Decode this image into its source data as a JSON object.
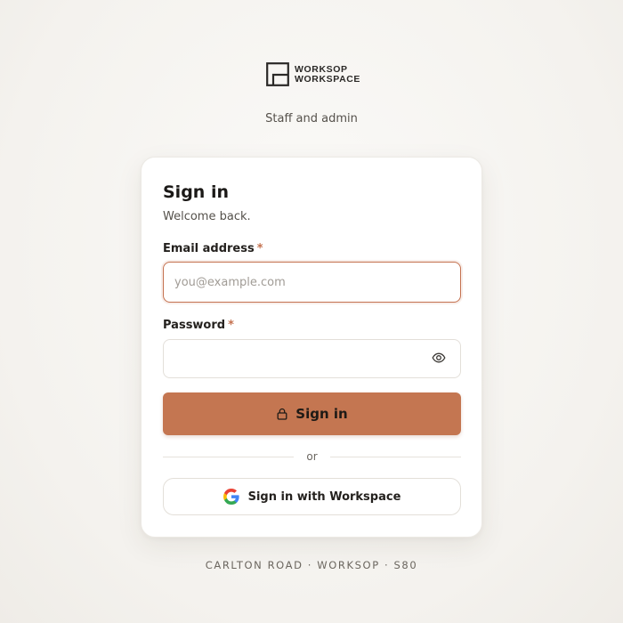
{
  "brand": {
    "line1": "WORKSOP",
    "line2": "WORKSPACE",
    "logo_icon": "workspace-logo-icon"
  },
  "tagline": "Staff and admin",
  "card": {
    "title": "Sign in",
    "subtitle": "Welcome back.",
    "email": {
      "label": "Email address",
      "required_mark": "*",
      "placeholder": "you@example.com",
      "value": ""
    },
    "password": {
      "label": "Password",
      "required_mark": "*",
      "value": "",
      "toggle_icon": "eye-icon"
    },
    "signin_button": {
      "label": "Sign in",
      "icon": "lock-icon"
    },
    "divider_text": "or",
    "sso_button": {
      "label": "Sign in with Workspace",
      "icon": "google-icon"
    }
  },
  "footer": "CARLTON ROAD · WORKSOP · S80",
  "colors": {
    "accent": "#c47651",
    "focus_border": "#c4714f",
    "required": "#c4714f",
    "background": "#f4f2ee",
    "card": "#ffffff"
  }
}
